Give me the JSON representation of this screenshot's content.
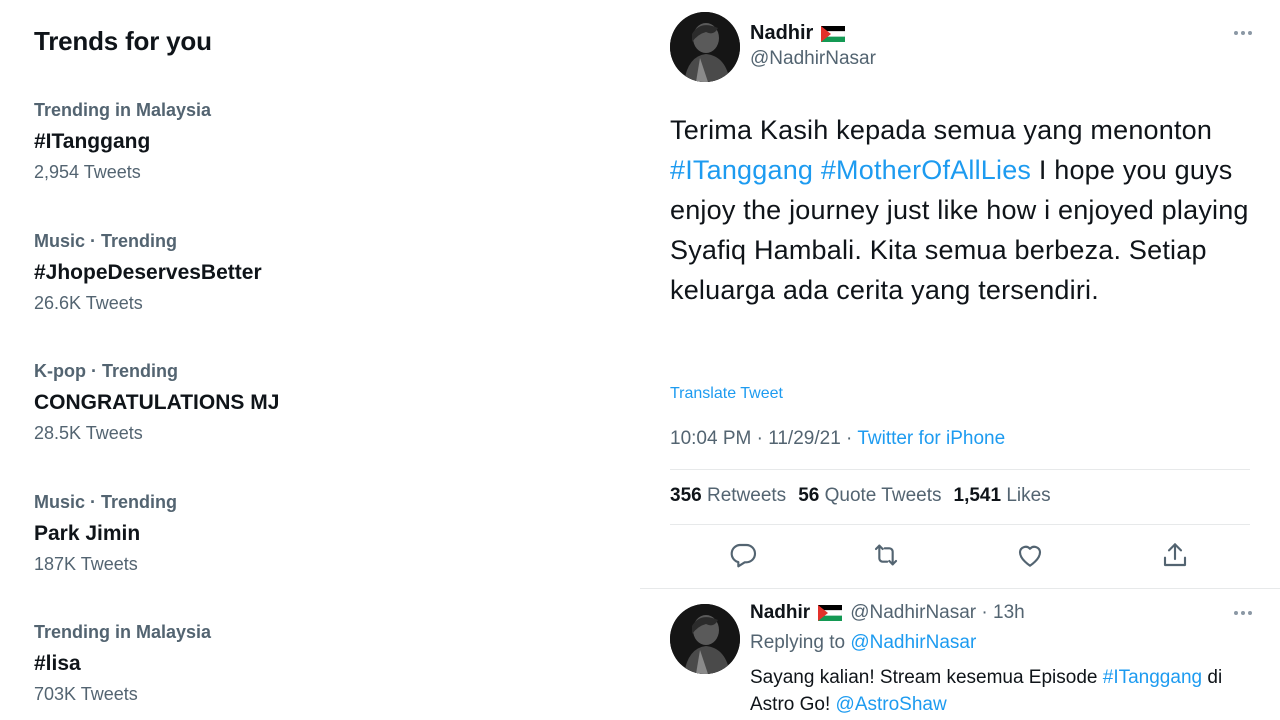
{
  "trends": {
    "title": "Trends for you",
    "items": [
      {
        "meta": "Trending in Malaysia",
        "name": "#ITanggang",
        "count": "2,954 Tweets"
      },
      {
        "meta": "Music · Trending",
        "name": "#JhopeDeservesBetter",
        "count": "26.6K Tweets"
      },
      {
        "meta": "K-pop · Trending",
        "name": "CONGRATULATIONS MJ",
        "count": "28.5K Tweets"
      },
      {
        "meta": "Music · Trending",
        "name": "Park Jimin",
        "count": "187K Tweets"
      },
      {
        "meta": "Trending in Malaysia",
        "name": "#lisa",
        "count": "703K Tweets"
      }
    ]
  },
  "tweet": {
    "author_name": "Nadhir",
    "author_handle": "@NadhirNasar",
    "text_part1": "Terima Kasih kepada semua yang menonton",
    "hashtag1": "#ITanggang",
    "hashtag2": "#MotherOfAllLies",
    "text_part2": "I hope you guys enjoy the journey just like how i enjoyed playing Syafiq Hambali. Kita semua berbeza. Setiap keluarga ada cerita yang tersendiri.",
    "translate_label": "Translate Tweet",
    "time": "10:04 PM · 11/29/21 ·",
    "source": "Twitter for iPhone",
    "retweets_count": "356",
    "retweets_label": "Retweets",
    "quotes_count": "56",
    "quotes_label": "Quote Tweets",
    "likes_count": "1,541",
    "likes_label": "Likes"
  },
  "reply": {
    "author_name": "Nadhir",
    "meta": "@NadhirNasar · 13h",
    "replying_prefix": "Replying to",
    "replying_to": "@NadhirNasar",
    "text_part1": "Sayang kalian! Stream kesemua Episode",
    "hashtag": "#ITanggang",
    "text_part2": "di Astro Go!",
    "mention": "@AstroShaw"
  },
  "colors": {
    "accent": "#1d9bf0",
    "secondary_text": "#536471",
    "primary_text": "#0f1419"
  },
  "icons": [
    "reply-icon",
    "retweet-icon",
    "like-icon",
    "share-icon",
    "more-icon",
    "palestine-flag-icon"
  ]
}
